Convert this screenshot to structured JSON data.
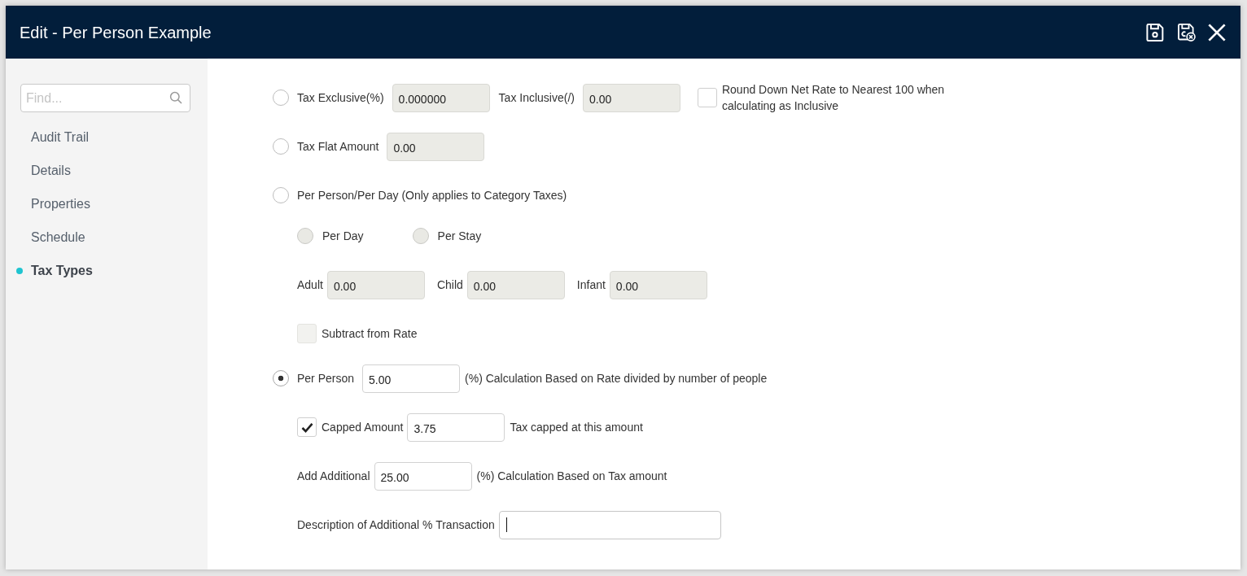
{
  "window": {
    "title": "Edit - Per Person Example"
  },
  "sidebar": {
    "search": {
      "placeholder": "Find..."
    },
    "items": [
      {
        "label": "Audit Trail",
        "selected": false
      },
      {
        "label": "Details",
        "selected": false
      },
      {
        "label": "Properties",
        "selected": false
      },
      {
        "label": "Schedule",
        "selected": false
      },
      {
        "label": "Tax Types",
        "selected": true
      }
    ]
  },
  "tax_exclusive": {
    "label": "Tax Exclusive(%)",
    "selected": false,
    "value": "0.000000",
    "disabled": true,
    "inclusive": {
      "label": "Tax Inclusive(/)",
      "value": "0.00",
      "disabled": true
    },
    "round_down": {
      "label": "Round Down Net Rate to Nearest 100 when calculating as Inclusive",
      "checked": false,
      "disabled": false
    }
  },
  "tax_flat_amount": {
    "label": "Tax Flat Amount",
    "selected": false,
    "value": "0.00",
    "disabled": true
  },
  "per_person_per_day": {
    "label": "Per Person/Per Day (Only applies to Category Taxes)",
    "selected": false,
    "period": [
      {
        "label": "Per Day",
        "selected": false,
        "disabled": true
      },
      {
        "label": "Per Stay",
        "selected": false,
        "disabled": true
      }
    ],
    "amounts": [
      {
        "label": "Adult",
        "value": "0.00",
        "disabled": true
      },
      {
        "label": "Child",
        "value": "0.00",
        "disabled": true
      },
      {
        "label": "Infant",
        "value": "0.00",
        "disabled": true
      }
    ],
    "subtract_from_rate": {
      "label": "Subtract from Rate",
      "checked": false,
      "disabled": true
    }
  },
  "per_person": {
    "label": "Per Person",
    "selected": true,
    "value": "5.00",
    "disabled": false,
    "note": "(%) Calculation Based on Rate divided by number of people",
    "capped_amount": {
      "label": "Capped Amount",
      "checked": true,
      "value": "3.75",
      "disabled": false,
      "note": "Tax capped at this amount"
    },
    "add_additional": {
      "label": "Add Additional",
      "value": "25.00",
      "disabled": false,
      "note": "(%) Calculation Based on Tax amount"
    },
    "description": {
      "label": "Description of Additional % Transaction",
      "focused": true
    }
  }
}
